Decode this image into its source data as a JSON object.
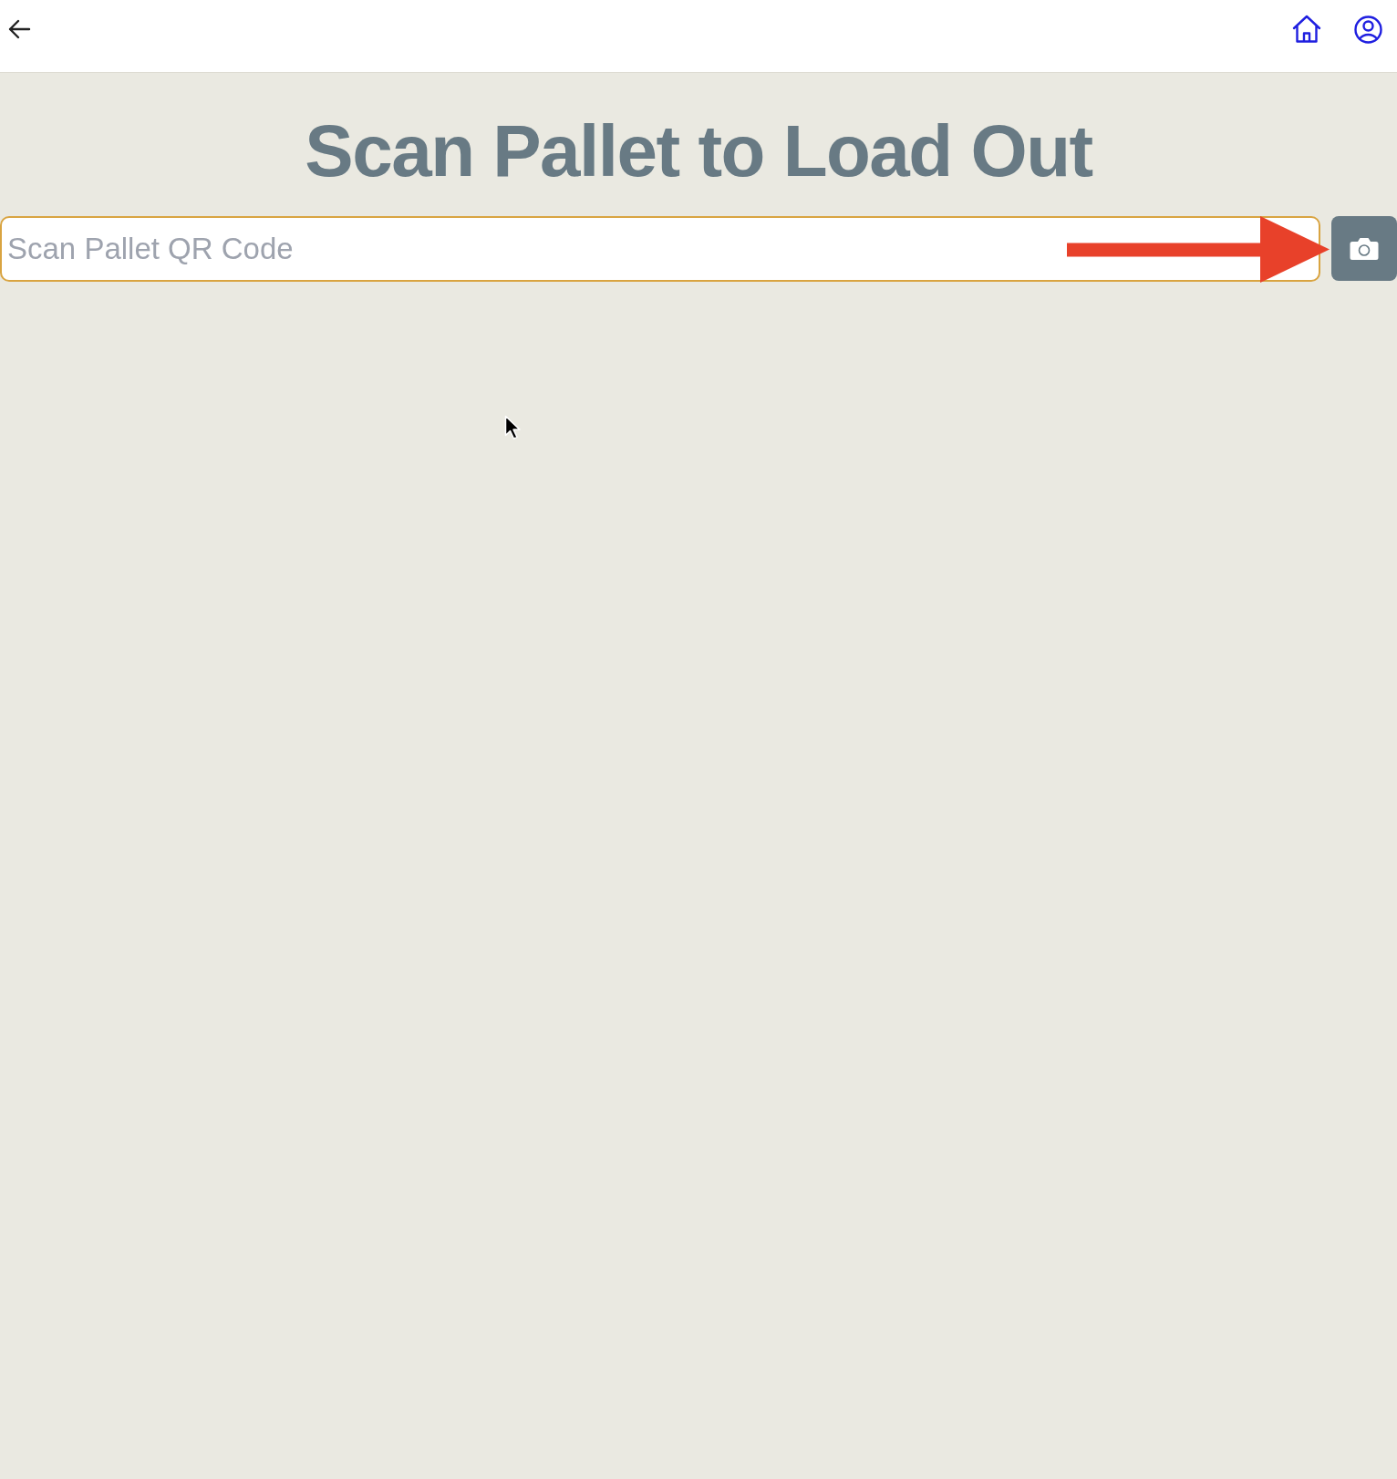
{
  "title": "Scan Pallet to Load Out",
  "scan_field": {
    "placeholder": "Scan Pallet QR Code",
    "focused": true
  }
}
